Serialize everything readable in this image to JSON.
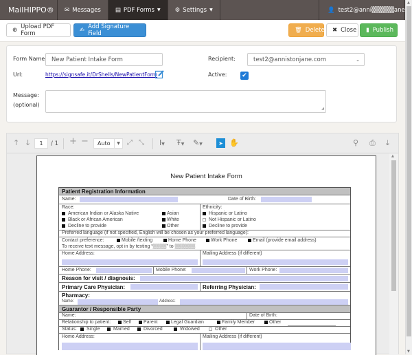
{
  "navbar": {
    "brand": "MailHIPPO®",
    "items": [
      {
        "label": "Messages",
        "icon": "envelope-icon"
      },
      {
        "label": "PDF Forms",
        "icon": "pdf-file-icon",
        "active": true
      },
      {
        "label": "Settings",
        "icon": "gear-icon"
      }
    ],
    "user": "test2@anni▒▒▒▒▒ane.com"
  },
  "toolbar": {
    "upload_label": "Upload PDF Form",
    "add_signature_label": "Add Signature Field",
    "delete_label": "Delete",
    "close_label": "Close",
    "publish_label": "Publish"
  },
  "form": {
    "form_name_label": "Form Name:",
    "form_name_value": "New Patient Intake Form",
    "url_label": "Url:",
    "url_value": "https://signsafe.it/DrShells/NewPatientForm",
    "recipient_label": "Recipient:",
    "recipient_value": "test2@annistonjane.com",
    "active_label": "Active:",
    "active_checked": true,
    "message_label": "Message:",
    "message_sublabel": "(optional)",
    "message_value": ""
  },
  "viewer": {
    "page_current": "1",
    "page_total": "/ 1",
    "zoom": "Auto"
  },
  "pdf": {
    "title": "New Patient Intake Form",
    "section1": "Patient Registration Information",
    "name": "Name:",
    "dob": "Date of Birth:",
    "race": "Race:",
    "race_options": [
      "American Indian or Alaska Native",
      "Black or African American",
      "Decline to provide"
    ],
    "race_options2": [
      "Asian",
      "White",
      "Other"
    ],
    "ethnicity": "Ethnicity:",
    "ethnicity_options": [
      "Hispanic or Latino",
      "Not Hispanic or Latino",
      "Decline to provide"
    ],
    "pref_lang": "Preferred language (if not specified, English will be chosen as your preferred language):",
    "contact_pref": "Contact preference:",
    "contact_options": [
      "Mobile /texting",
      "Home Phone",
      "Work Phone",
      "Email (provide email address)"
    ],
    "text_optin": "To receive text message, opt in by texting “▒▒▒▒” to ▒▒▒▒▒▒",
    "home_address": "Home Address:",
    "mailing_address": "Mailing Address (if different)",
    "home_phone": "Home Phone:",
    "mobile_phone": "Mobile Phone:",
    "work_phone": "Work Phone:",
    "reason": "Reason for visit / diagnosis:",
    "pcp": "Primary Care Physician:",
    "referring": "Referring Physician:",
    "pharmacy": "Pharmacy:",
    "pharm_name": "Name:",
    "pharm_address": "Address:",
    "section2": "Guarantor / Responsible Party",
    "g_name": "Name:",
    "g_dob": "Date of Birth:",
    "relationship": "Relationship to patient:",
    "relationship_options": [
      "Self",
      "Parent",
      "Legal Guardian",
      "Family Member",
      "Other"
    ],
    "status": "Status:",
    "status_options": [
      "Single",
      "Married",
      "Divorced",
      "Widowed",
      "Other"
    ],
    "g_home_address": "Home Address:",
    "g_mailing_address": "Mailing Address (if different)"
  }
}
